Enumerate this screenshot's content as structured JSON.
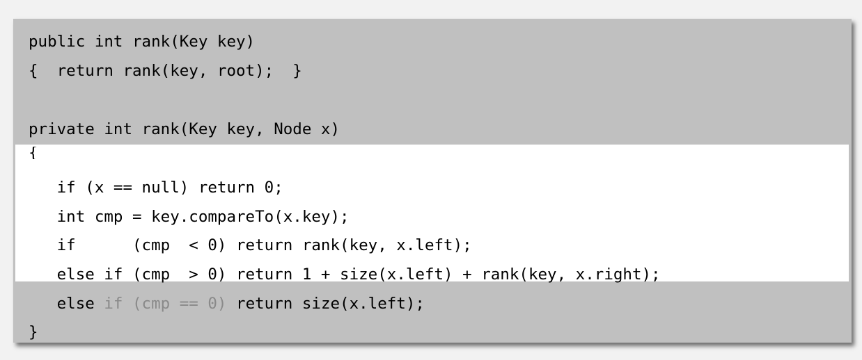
{
  "code_lines": {
    "l1": "public int rank(Key key)",
    "l2": "{  return rank(key, root);  }",
    "l3": "",
    "l4": "private int rank(Key key, Node x)",
    "l5": "{",
    "l6": "   if (x == null) return 0;",
    "l7": "   int cmp = key.compareTo(x.key);",
    "l8": "   if      (cmp  < 0) return rank(key, x.left);",
    "l9": "   else if (cmp  > 0) return 1 + size(x.left) + rank(key, x.right);",
    "l10_prefix": "   else ",
    "l10_dim": "if (cmp == 0)",
    "l10_suffix": " return size(x.left);",
    "l11": "}"
  },
  "colors": {
    "panel": "#c0c0c0",
    "highlight": "#ffffff",
    "dim_text": "#8a8a8a"
  }
}
